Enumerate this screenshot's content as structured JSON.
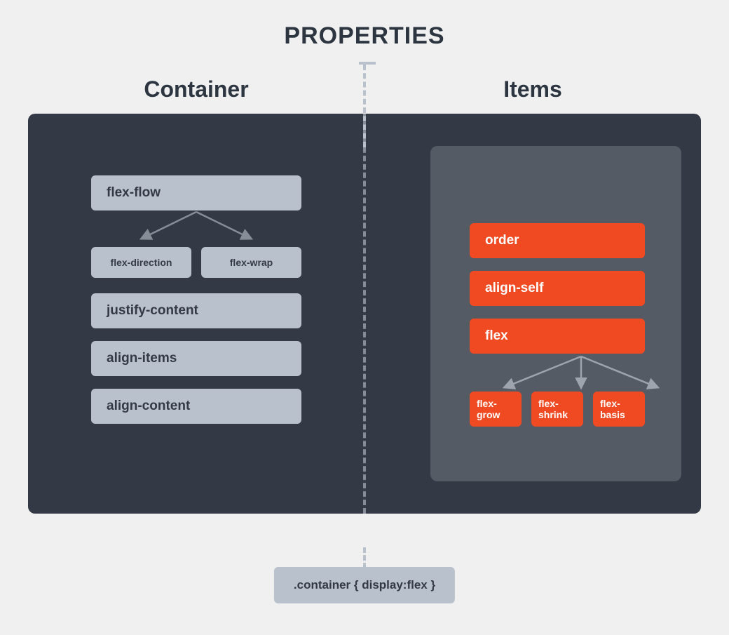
{
  "heading": "PROPERTIES",
  "left": {
    "title": "Container",
    "flex_flow": "flex-flow",
    "flex_direction": "flex-direction",
    "flex_wrap": "flex-wrap",
    "justify_content": "justify-content",
    "align_items": "align-items",
    "align_content": "align-content"
  },
  "right": {
    "title": "Items",
    "order": "order",
    "align_self": "align-self",
    "flex": "flex",
    "flex_grow": "flex-grow",
    "flex_shrink": "flex-shrink",
    "flex_basis": "flex-basis"
  },
  "footer": ".container { display:flex }"
}
